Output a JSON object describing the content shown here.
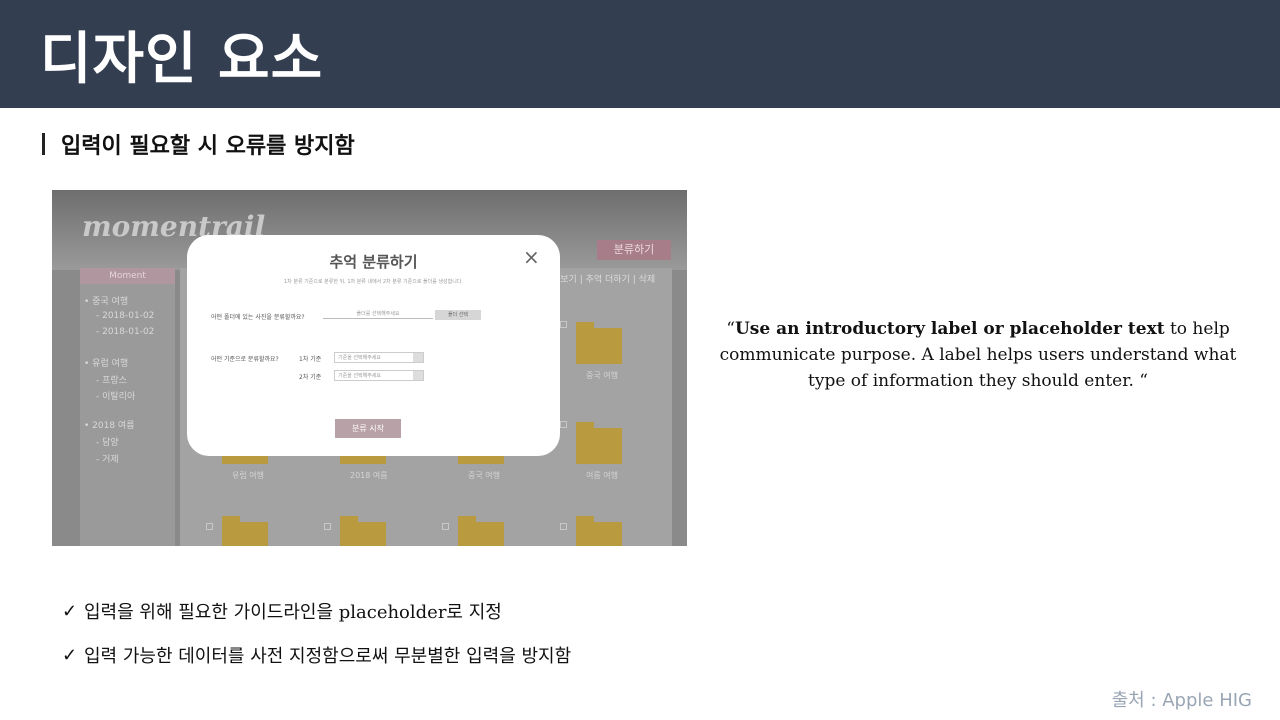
{
  "header": {
    "title": "디자인 요소"
  },
  "section": {
    "heading": "입력이 필요할 시 오류를 방지함"
  },
  "screenshot": {
    "logo": "momentrail",
    "top_button": "분류하기",
    "sidebar": {
      "head": "Moment",
      "items": [
        "• 중국 여행",
        "- 2018-01-02",
        "- 2018-01-02",
        "• 유럽 여행",
        "- 프랑스",
        "- 이탈리아",
        "• 2018 여름",
        "- 담양",
        "- 거제"
      ]
    },
    "nav": "리보기 | 추억 더하기 | 삭제",
    "folders": [
      "중국 여행",
      "유럽 여행",
      "2018 여름",
      "중국 여행",
      "여름 여행"
    ],
    "modal": {
      "title": "추억 분류하기",
      "close": "×",
      "subtitle": "1차 분류 기준으로 분류한 뒤, 1차 분류 내에서 2차 분류 기준으로 폴더를 생성합니다.",
      "q1_label": "어떤 폴더에 있는 사진을 분류할까요?",
      "q1_placeholder": "폴더를 선택해주세요",
      "q1_button": "폴더 선택",
      "q2_label": "어떤 기준으로 분류할까요?",
      "criteria1_label": "1차 기준",
      "criteria1_placeholder": "기준을 선택해주세요",
      "criteria2_label": "2차 기준",
      "criteria2_placeholder": "기준을 선택해주세요",
      "submit": "분류 시작"
    }
  },
  "quote": {
    "open_mark": "“",
    "bold": "Use an introductory label or placeholder text",
    "rest": " to help communicate purpose. A label helps users understand what type of information they should enter. ",
    "close_mark": "“"
  },
  "bullets": [
    {
      "icon": "check-icon",
      "text": "입력을 위해 필요한 가이드라인을 placeholder로 지정"
    },
    {
      "icon": "check-icon",
      "text": "입력 가능한 데이터를 사전 지정함으로써 무분별한 입력을 방지함"
    }
  ],
  "check_glyph": "✓",
  "source": "출처 : Apple HIG",
  "colors": {
    "header_bg": "#343e51",
    "source_text": "#9aa6b5"
  }
}
